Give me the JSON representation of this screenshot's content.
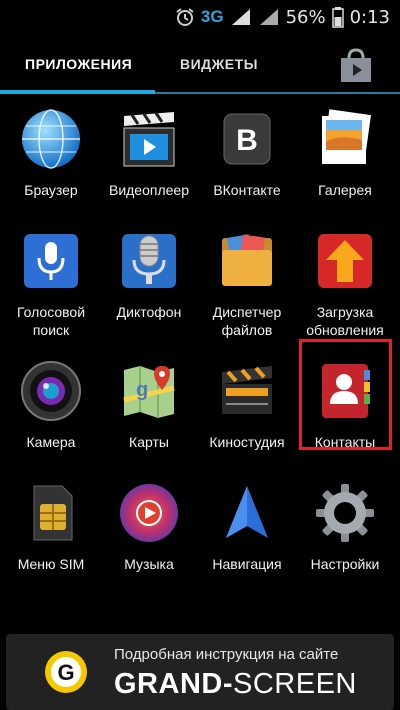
{
  "status_bar": {
    "network": "3G",
    "battery_percent": "56%",
    "time": "0:13",
    "icons": [
      "alarm-icon",
      "signal-icon",
      "signal-icon",
      "battery-icon"
    ]
  },
  "tabs": [
    {
      "label": "ПРИЛОЖЕНИЯ",
      "active": true
    },
    {
      "label": "ВИДЖЕТЫ",
      "active": false
    }
  ],
  "store_icon": "shopping-bag-icon",
  "apps": [
    {
      "label": "Браузер",
      "icon": "browser-globe-icon"
    },
    {
      "label": "Видеоплеер",
      "icon": "video-player-icon"
    },
    {
      "label": "ВКонтакте",
      "icon": "vk-icon"
    },
    {
      "label": "Галерея",
      "icon": "gallery-icon"
    },
    {
      "label": "Голосовой поиск",
      "icon": "microphone-icon"
    },
    {
      "label": "Диктофон",
      "icon": "dictaphone-microphone-icon"
    },
    {
      "label": "Диспетчер файлов",
      "icon": "folder-icon"
    },
    {
      "label": "Загрузка обновления",
      "icon": "update-arrow-icon"
    },
    {
      "label": "Камера",
      "icon": "camera-lens-icon"
    },
    {
      "label": "Карты",
      "icon": "maps-icon"
    },
    {
      "label": "Киностудия",
      "icon": "clapperboard-icon"
    },
    {
      "label": "Контакты",
      "icon": "contacts-icon",
      "highlighted": true
    },
    {
      "label": "Меню SIM",
      "icon": "sim-card-icon"
    },
    {
      "label": "Музыка",
      "icon": "music-icon"
    },
    {
      "label": "Навигация",
      "icon": "navigation-arrow-icon"
    },
    {
      "label": "Настройки",
      "icon": "settings-gear-icon"
    }
  ],
  "banner": {
    "subtitle": "Подробная инструкция на сайте",
    "title_bold": "GRAND-",
    "title_rest": "SCREEN",
    "logo_letter": "G"
  },
  "colors": {
    "accent": "#1fa8e0",
    "highlight": "#e0202a",
    "background": "#000000"
  }
}
